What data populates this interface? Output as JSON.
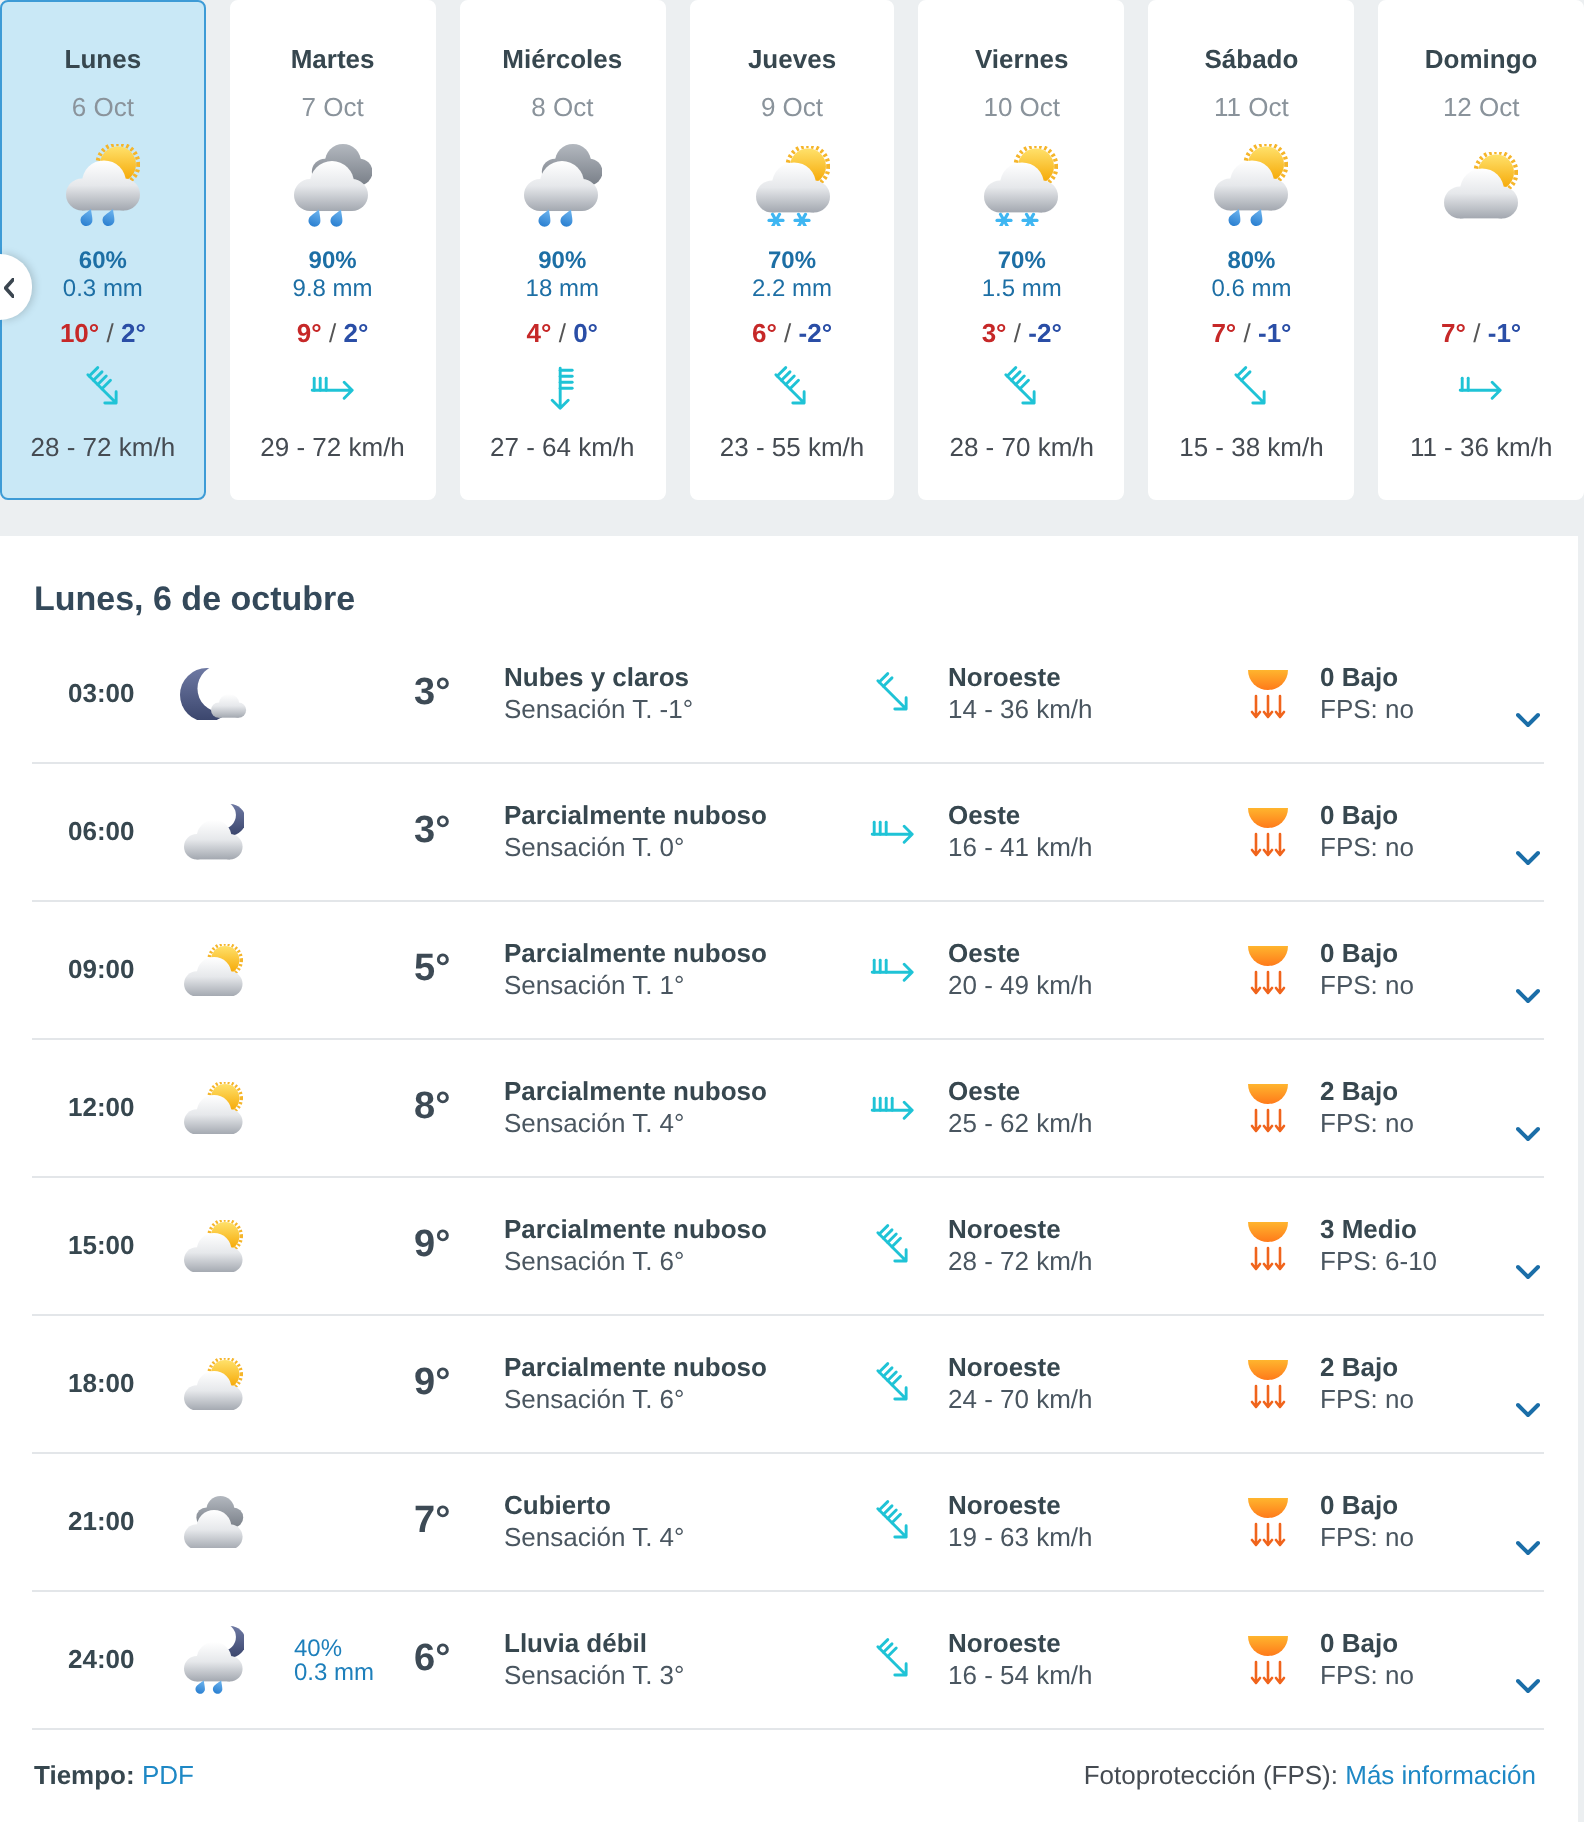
{
  "days": [
    {
      "name": "Lunes",
      "date": "6 Oct",
      "selected": true,
      "sky": {
        "kind": "cloud-sun-rain"
      },
      "rain_chance": "60%",
      "rain_amount": "0.3 mm",
      "max": "10°",
      "separator": "/",
      "min": "2°",
      "wind_arrow": {
        "kind": "southeast-strong"
      },
      "wind": "28 - 72 km/h"
    },
    {
      "name": "Martes",
      "date": "7 Oct",
      "selected": false,
      "sky": {
        "kind": "rain-clouds"
      },
      "rain_chance": "90%",
      "rain_amount": "9.8 mm",
      "max": "9°",
      "separator": "/",
      "min": "2°",
      "wind_arrow": {
        "kind": "east-moderate"
      },
      "wind": "29 - 72 km/h"
    },
    {
      "name": "Miércoles",
      "date": "8 Oct",
      "selected": false,
      "sky": {
        "kind": "rain-clouds"
      },
      "rain_chance": "90%",
      "rain_amount": "18 mm",
      "max": "4°",
      "separator": "/",
      "min": "0°",
      "wind_arrow": {
        "kind": "south-strong"
      },
      "wind": "27 - 64 km/h"
    },
    {
      "name": "Jueves",
      "date": "9 Oct",
      "selected": false,
      "sky": {
        "kind": "cloud-sun-snow"
      },
      "rain_chance": "70%",
      "rain_amount": "2.2 mm",
      "max": "6°",
      "separator": "/",
      "min": "-2°",
      "wind_arrow": {
        "kind": "southeast-strong"
      },
      "wind": "23 - 55 km/h"
    },
    {
      "name": "Viernes",
      "date": "10 Oct",
      "selected": false,
      "sky": {
        "kind": "cloud-sun-snow"
      },
      "rain_chance": "70%",
      "rain_amount": "1.5 mm",
      "max": "3°",
      "separator": "/",
      "min": "-2°",
      "wind_arrow": {
        "kind": "southeast-strong"
      },
      "wind": "28 - 70 km/h"
    },
    {
      "name": "Sábado",
      "date": "11 Oct",
      "selected": false,
      "sky": {
        "kind": "cloud-sun-rain"
      },
      "rain_chance": "80%",
      "rain_amount": "0.6 mm",
      "max": "7°",
      "separator": "/",
      "min": "-1°",
      "wind_arrow": {
        "kind": "southeast-light"
      },
      "wind": "15 - 38 km/h"
    },
    {
      "name": "Domingo",
      "date": "12 Oct",
      "selected": false,
      "sky": {
        "kind": "cloud-sun"
      },
      "max": "7°",
      "separator": "/",
      "min": "-1°",
      "wind_arrow": {
        "kind": "east-light"
      },
      "wind": "11 - 36 km/h"
    }
  ],
  "day_title": "Lunes, 6 de octubre",
  "hours": [
    {
      "time": "03:00",
      "sky": {
        "kind": "moon-cloud"
      },
      "temp": "3°",
      "condition": "Nubes y claros",
      "feels_like": "Sensación T. -1°",
      "wind_arrow": {
        "kind": "southeast-light"
      },
      "wind_direction": "Noroeste",
      "wind_speed": "14 - 36 km/h",
      "uv": "0 Bajo",
      "fps": "FPS: no",
      "expanded": false
    },
    {
      "time": "06:00",
      "sky": {
        "kind": "cloud-moon"
      },
      "temp": "3°",
      "condition": "Parcialmente nuboso",
      "feels_like": "Sensación T. 0°",
      "wind_arrow": {
        "kind": "east-moderate"
      },
      "wind_direction": "Oeste",
      "wind_speed": "16 - 41 km/h",
      "uv": "0 Bajo",
      "fps": "FPS: no",
      "expanded": false
    },
    {
      "time": "09:00",
      "sky": {
        "kind": "cloud-sun"
      },
      "temp": "5°",
      "condition": "Parcialmente nuboso",
      "feels_like": "Sensación T. 1°",
      "wind_arrow": {
        "kind": "east-moderate"
      },
      "wind_direction": "Oeste",
      "wind_speed": "20 - 49 km/h",
      "uv": "0 Bajo",
      "fps": "FPS: no",
      "expanded": false
    },
    {
      "time": "12:00",
      "sky": {
        "kind": "cloud-sun"
      },
      "temp": "8°",
      "condition": "Parcialmente nuboso",
      "feels_like": "Sensación T. 4°",
      "wind_arrow": {
        "kind": "east-strong"
      },
      "wind_direction": "Oeste",
      "wind_speed": "25 - 62 km/h",
      "uv": "2 Bajo",
      "fps": "FPS: no",
      "expanded": false
    },
    {
      "time": "15:00",
      "sky": {
        "kind": "cloud-sun"
      },
      "temp": "9°",
      "condition": "Parcialmente nuboso",
      "feels_like": "Sensación T. 6°",
      "wind_arrow": {
        "kind": "southeast-strong"
      },
      "wind_direction": "Noroeste",
      "wind_speed": "28 - 72 km/h",
      "uv": "3 Medio",
      "fps": "FPS: 6-10",
      "expanded": false
    },
    {
      "time": "18:00",
      "sky": {
        "kind": "cloud-sun"
      },
      "temp": "9°",
      "condition": "Parcialmente nuboso",
      "feels_like": "Sensación T. 6°",
      "wind_arrow": {
        "kind": "southeast-strong"
      },
      "wind_direction": "Noroeste",
      "wind_speed": "24 - 70 km/h",
      "uv": "2 Bajo",
      "fps": "FPS: no",
      "expanded": false
    },
    {
      "time": "21:00",
      "sky": {
        "kind": "overcast"
      },
      "temp": "7°",
      "condition": "Cubierto",
      "feels_like": "Sensación T. 4°",
      "wind_arrow": {
        "kind": "southeast-strong"
      },
      "wind_direction": "Noroeste",
      "wind_speed": "19 - 63 km/h",
      "uv": "0 Bajo",
      "fps": "FPS: no",
      "expanded": false
    },
    {
      "time": "24:00",
      "sky": {
        "kind": "cloud-moon-rain"
      },
      "rain_chance": "40%",
      "rain_amount": "0.3 mm",
      "temp": "6°",
      "condition": "Lluvia débil",
      "feels_like": "Sensación T. 3°",
      "wind_arrow": {
        "kind": "southeast-moderate"
      },
      "wind_direction": "Noroeste",
      "wind_speed": "16 - 54 km/h",
      "uv": "0 Bajo",
      "fps": "FPS: no",
      "expanded": false
    }
  ],
  "footer": {
    "pdf": {
      "label": "Tiempo:",
      "link": "PDF"
    },
    "sunscreen": {
      "label": "Fotoprotección (FPS):",
      "link": "Más información"
    }
  }
}
